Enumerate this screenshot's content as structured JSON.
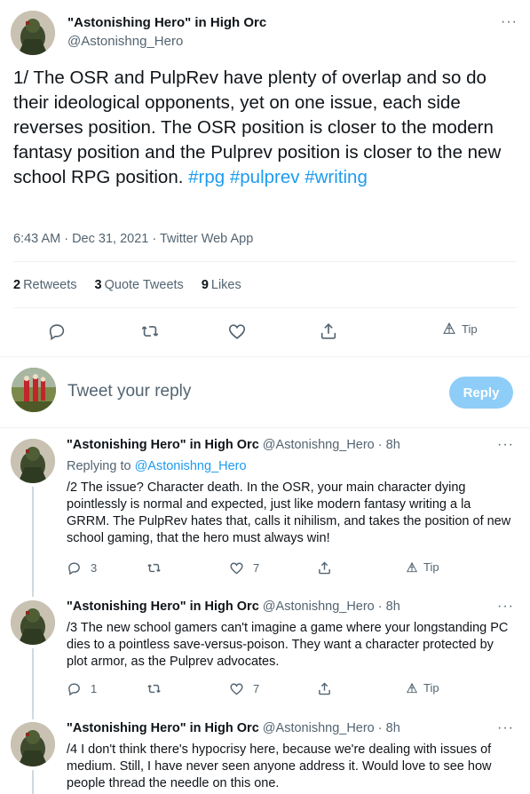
{
  "main_tweet": {
    "author_name": "\"Astonishing Hero\" in High Orc",
    "author_handle": "@Astonishng_Hero",
    "text_parts": [
      "1/ The OSR and PulpRev have plenty of overlap and so do their ideological opponents, yet on one issue, each side reverses position. The OSR position is closer to the modern fantasy position and the Pulprev position is closer to the new school RPG position. ",
      "#rpg",
      " ",
      "#pulprev",
      " ",
      "#writing"
    ],
    "timestamp": "6:43 AM · Dec 31, 2021 · Twitter Web App",
    "stats": {
      "retweets_count": "2",
      "retweets_label": "Retweets",
      "quote_count": "3",
      "quote_label": "Quote Tweets",
      "likes_count": "9",
      "likes_label": "Likes"
    },
    "tip_label": "Tip"
  },
  "reply_composer": {
    "placeholder": "Tweet your reply",
    "button_label": "Reply"
  },
  "replies": [
    {
      "author_name": "\"Astonishing Hero\" in High Orc",
      "handle_time": "@Astonishng_Hero · 8h",
      "replying_prefix": "Replying to ",
      "replying_to": "@Astonishng_Hero",
      "text": "/2 The issue? Character death. In the OSR, your main character dying pointlessly is normal and expected, just like modern fantasy writing a la GRRM. The PulpRev hates that, calls it nihilism, and takes the position of new school gaming, that the hero must always win!",
      "reply_count": "3",
      "like_count": "7",
      "tip_label": "Tip"
    },
    {
      "author_name": "\"Astonishing Hero\" in High Orc",
      "handle_time": "@Astonishng_Hero · 8h",
      "text": "/3 The new school gamers can't imagine a game where your longstanding PC dies to a pointless save-versus-poison. They want a character protected by plot armor, as the Pulprev advocates.",
      "reply_count": "1",
      "like_count": "7",
      "tip_label": "Tip"
    },
    {
      "author_name": "\"Astonishing Hero\" in High Orc",
      "handle_time": "@Astonishng_Hero · 8h",
      "text": "/4 I don't think there's hypocrisy here, because we're dealing with issues of medium. Still, I have never seen anyone address it. Would love to see how people thread the needle on this one."
    }
  ],
  "more_icon_glyph": "···",
  "colors": {
    "accent": "#1d9bf0",
    "secondary_text": "#536471",
    "reply_button_disabled": "#8ecdf8"
  }
}
